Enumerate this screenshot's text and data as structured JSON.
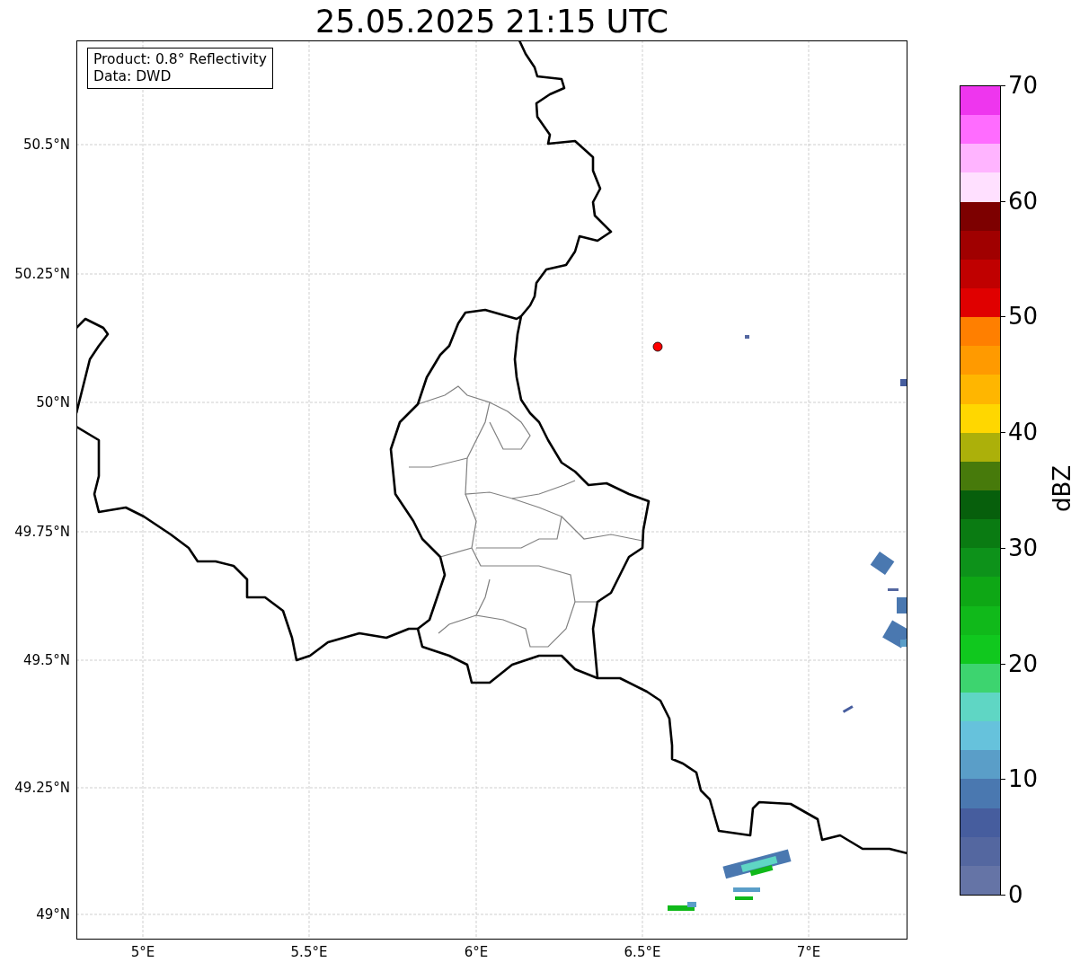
{
  "title": "25.05.2025 21:15 UTC",
  "info_box": [
    "Product: 0.8° Reflectivity",
    "Data: DWD"
  ],
  "lat_ticks": [
    "50.5°N",
    "50.25°N",
    "50°N",
    "49.75°N",
    "49.5°N",
    "49.25°N",
    "49°N"
  ],
  "lon_ticks": [
    "5°E",
    "5.5°E",
    "6°E",
    "6.5°E",
    "7°E"
  ],
  "colorbar": {
    "label": "dBZ",
    "ticks": [
      "70",
      "60",
      "50",
      "40",
      "30",
      "20",
      "10",
      "0"
    ],
    "bands": [
      {
        "color": "#6574a6"
      },
      {
        "color": "#5467a0"
      },
      {
        "color": "#465d9e"
      },
      {
        "color": "#4a78b0"
      },
      {
        "color": "#5a9ec8"
      },
      {
        "color": "#66c2dc"
      },
      {
        "color": "#5fd6c4"
      },
      {
        "color": "#3dd46f"
      },
      {
        "color": "#10c81e"
      },
      {
        "color": "#10b91a"
      },
      {
        "color": "#0ea715"
      },
      {
        "color": "#0d921a"
      },
      {
        "color": "#0a7b12"
      },
      {
        "color": "#075f0c"
      },
      {
        "color": "#477a0b"
      },
      {
        "color": "#acb00a"
      },
      {
        "color": "#ffd700"
      },
      {
        "color": "#ffb600"
      },
      {
        "color": "#ff9a00"
      },
      {
        "color": "#ff7f00"
      },
      {
        "color": "#e00000"
      },
      {
        "color": "#c00000"
      },
      {
        "color": "#a00000"
      },
      {
        "color": "#7d0000"
      },
      {
        "color": "#ffe0ff"
      },
      {
        "color": "#ffb4ff"
      },
      {
        "color": "#ff6cff"
      },
      {
        "color": "#ee36ee"
      }
    ]
  }
}
